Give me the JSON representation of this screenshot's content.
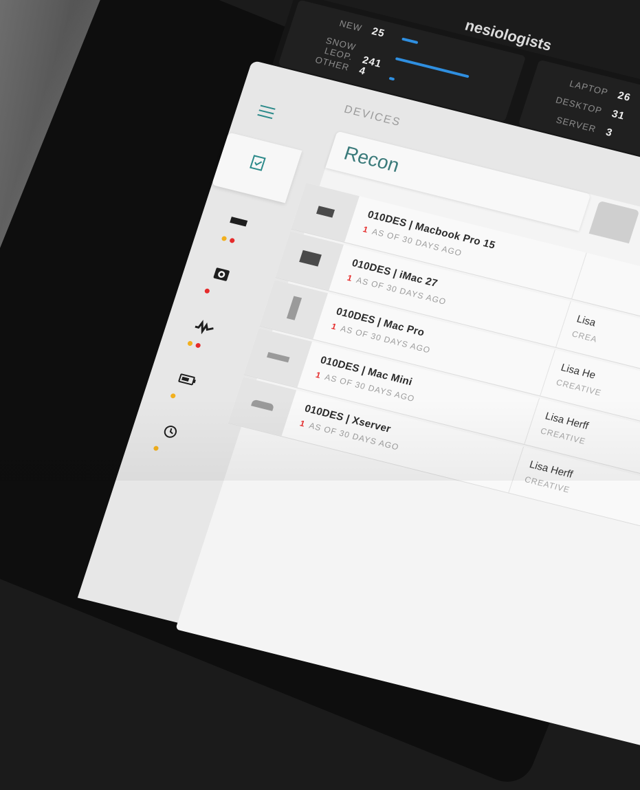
{
  "brand": {
    "title": "nesiologists"
  },
  "stats_left": [
    {
      "label": "NEW",
      "value": "25",
      "bar": 0.12
    },
    {
      "label": "SNOW LEOP.",
      "value": "241",
      "bar": 1.0
    },
    {
      "label": "OTHER",
      "value": "4",
      "bar": 0.05
    }
  ],
  "stats_right": [
    {
      "label": "LAPTOP",
      "value": "26"
    },
    {
      "label": "DESKTOP",
      "value": "31"
    },
    {
      "label": "SERVER",
      "value": "3"
    }
  ],
  "header": {
    "title": "DEVICES"
  },
  "tab": {
    "label": "Recon"
  },
  "devices": [
    {
      "name": "010DES | Macbook Pro 15",
      "count": "1",
      "status": "AS OF 30 DAYS AGO",
      "owner": "",
      "dept": ""
    },
    {
      "name": "010DES | iMac 27",
      "count": "1",
      "status": "AS OF 30 DAYS AGO",
      "owner": "Lisa",
      "dept": "CREA"
    },
    {
      "name": "010DES | Mac Pro",
      "count": "1",
      "status": "AS OF 30 DAYS AGO",
      "owner": "Lisa He",
      "dept": "CREATIVE"
    },
    {
      "name": "010DES | Mac Mini",
      "count": "1",
      "status": "AS OF 30 DAYS AGO",
      "owner": "Lisa Herff",
      "dept": "CREATIVE"
    },
    {
      "name": "010DES | Xserver",
      "count": "1",
      "status": "AS OF 30 DAYS AGO",
      "owner": "Lisa Herff",
      "dept": "CREATIVE"
    }
  ],
  "sidebar": {
    "items": [
      {
        "icon": "checklist-icon",
        "dots": []
      },
      {
        "icon": "laptop-icon",
        "dots": [
          "#f2b01e",
          "#e52b2b"
        ]
      },
      {
        "icon": "camera-icon",
        "dots": [
          "#e52b2b"
        ]
      },
      {
        "icon": "activity-icon",
        "dots": [
          "#f2b01e",
          "#e52b2b"
        ]
      },
      {
        "icon": "battery-icon",
        "dots": [
          "#f2b01e"
        ]
      },
      {
        "icon": "clock-icon",
        "dots": [
          "#f2b01e"
        ]
      }
    ]
  },
  "colors": {
    "accent": "#2c8a8a",
    "bar": "#2f8fe0",
    "alert": "#e52b2b",
    "warn": "#f2b01e"
  }
}
